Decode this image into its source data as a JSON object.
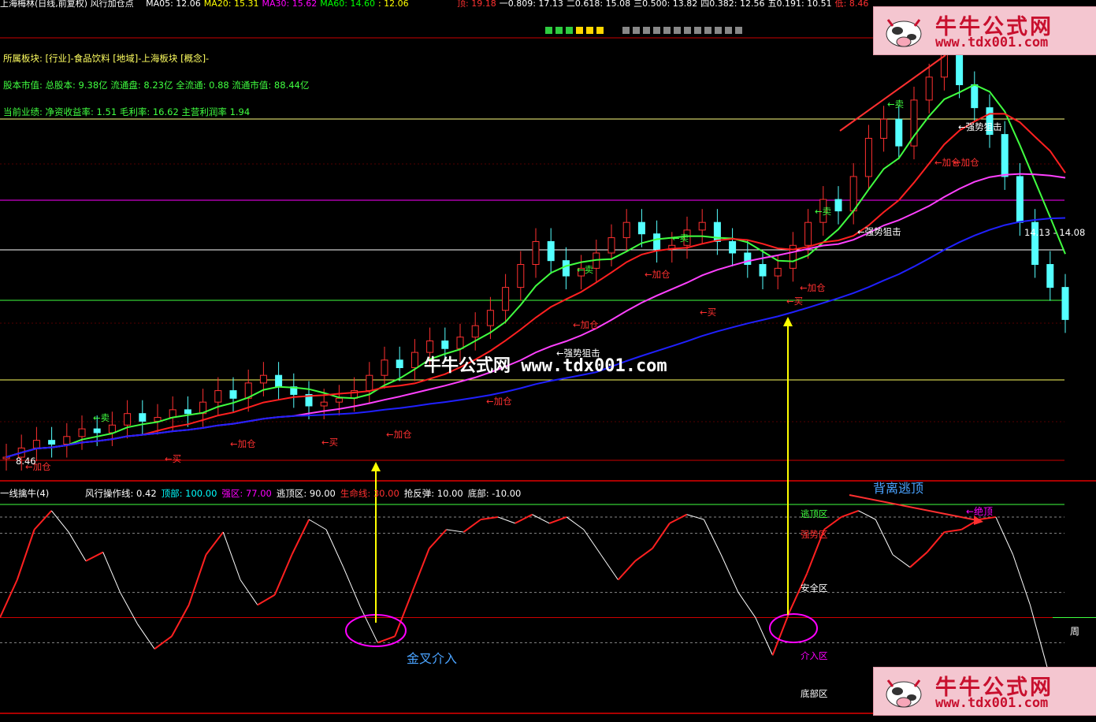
{
  "header": {
    "title": "上海梅林(日线,前复权) 风行加仓点",
    "ma": [
      {
        "label": "MA05: 12.06",
        "color": "#ffffff"
      },
      {
        "label": "MA20: 15.31",
        "color": "#ffff00"
      },
      {
        "label": "MA30: 15.62",
        "color": "#ff00ff"
      },
      {
        "label": "MA60: 14.60",
        "color": "#00ff00"
      },
      {
        "label": ": 12.06",
        "color": "#ffff00"
      }
    ],
    "levels": [
      {
        "label": "顶: 19.18",
        "color": "#ff3030"
      },
      {
        "label": "一0.809: 17.13",
        "color": "#ffffff"
      },
      {
        "label": "二0.618: 15.08",
        "color": "#ffffff"
      },
      {
        "label": "三0.500: 13.82",
        "color": "#ffffff"
      },
      {
        "label": "四0.382: 12.56",
        "color": "#ffffff"
      },
      {
        "label": "五0.191: 10.51",
        "color": "#ffffff"
      },
      {
        "label": "低: 8.46",
        "color": "#ff3030"
      }
    ]
  },
  "info_lines": [
    {
      "text": "所属板块: [行业]-食品饮料 [地域]-上海板块 [概念]-",
      "color": "#ffff60"
    },
    {
      "text": "股本市值: 总股本: 9.38亿 流通盘: 8.23亿 全流通: 0.88 流通市值: 88.44亿",
      "color": "#40ff40"
    },
    {
      "text": "当前业绩: 净资收益率: 1.51 毛利率: 16.62 主营利润率 1.94",
      "color": "#40ff40"
    }
  ],
  "watermark": {
    "site_name": "牛牛公式网",
    "site_url": "www.tdx001.com",
    "center_text": "牛牛公式网 www.tdx001.com"
  },
  "upper_annotations": [
    {
      "text": "←卖",
      "color": "#40ff40"
    },
    {
      "text": "←卖",
      "color": "#40ff40"
    },
    {
      "text": "←卖",
      "color": "#40ff40"
    },
    {
      "text": "←卖",
      "color": "#40ff40"
    },
    {
      "text": "←卖",
      "color": "#40ff40"
    },
    {
      "text": "←买",
      "color": "#ff3030"
    },
    {
      "text": "←买",
      "color": "#ff3030"
    },
    {
      "text": "←买",
      "color": "#ff3030"
    },
    {
      "text": "←买",
      "color": "#ff3030"
    },
    {
      "text": "←加仓",
      "color": "#ff3030"
    },
    {
      "text": "←加仓",
      "color": "#ff3030"
    },
    {
      "text": "←加仓",
      "color": "#ff3030"
    },
    {
      "text": "←加仓",
      "color": "#ff3030"
    },
    {
      "text": "←加仓",
      "color": "#ff3030"
    },
    {
      "text": "←加仓",
      "color": "#ff3030"
    },
    {
      "text": "←加仓",
      "color": "#ff3030"
    },
    {
      "text": "←加仓",
      "color": "#ff3030"
    },
    {
      "text": "←加仓",
      "color": "#ff3030"
    },
    {
      "text": "←强势狙击",
      "color": "#ffffff"
    },
    {
      "text": "←强势狙击",
      "color": "#ffffff"
    },
    {
      "text": "←强势狙击",
      "color": "#ffffff"
    },
    {
      "text": "8.46",
      "color": "#ffffff"
    },
    {
      "text": "14.13 - 14.08",
      "color": "#ffffff"
    }
  ],
  "indicator": {
    "title": "一线擒牛(4)",
    "params": [
      {
        "text": "风行操作线: 0.42",
        "color": "#ffffff"
      },
      {
        "text": "顶部: 100.00",
        "color": "#00ffff"
      },
      {
        "text": "强区: 77.00",
        "color": "#ff00ff"
      },
      {
        "text": "逃顶区: 90.00",
        "color": "#ffffff"
      },
      {
        "text": "生命线: 30.00",
        "color": "#ff3030"
      },
      {
        "text": "抢反弹: 10.00",
        "color": "#ffffff"
      },
      {
        "text": "底部: -10.00",
        "color": "#ffffff"
      }
    ],
    "zones": [
      {
        "text": "逃顶区",
        "color": "#40ff40"
      },
      {
        "text": "强势区",
        "color": "#ff3030"
      },
      {
        "text": "安全区",
        "color": "#ffffff"
      },
      {
        "text": "介入区",
        "color": "#ff00ff"
      },
      {
        "text": "底部区",
        "color": "#ffffff"
      }
    ],
    "annotations": [
      {
        "text": "金叉介入",
        "color": "#4aa3ff"
      },
      {
        "text": "背离逃顶",
        "color": "#4aa3ff"
      },
      {
        "text": "←绝顶",
        "color": "#ff00ff"
      },
      {
        "text": "周",
        "color": "#ffffff"
      }
    ]
  },
  "chart_data": {
    "type": "candlestick+line",
    "price_levels": [
      19.18,
      17.13,
      15.08,
      13.82,
      12.56,
      10.51,
      8.46
    ],
    "oscillator_levels": [
      100,
      90,
      77,
      30,
      10,
      -10
    ],
    "series": [
      {
        "name": "MA05",
        "color": "#ffffff"
      },
      {
        "name": "MA20",
        "color": "#ffff00"
      },
      {
        "name": "MA30",
        "color": "#ff00ff"
      },
      {
        "name": "MA60",
        "color": "#00ff00"
      }
    ],
    "closes_est": [
      8.46,
      8.7,
      8.9,
      8.8,
      9.0,
      9.2,
      9.1,
      9.3,
      9.6,
      9.4,
      9.5,
      9.7,
      9.6,
      9.9,
      10.2,
      10.0,
      10.4,
      10.6,
      10.3,
      10.1,
      9.8,
      9.9,
      10.0,
      10.2,
      10.6,
      11.0,
      10.8,
      11.2,
      11.5,
      11.3,
      11.6,
      11.9,
      12.3,
      12.9,
      13.5,
      14.1,
      13.6,
      13.2,
      13.4,
      13.8,
      14.2,
      14.6,
      14.3,
      13.9,
      14.0,
      14.4,
      14.6,
      14.1,
      13.8,
      13.5,
      13.2,
      13.4,
      14.0,
      14.6,
      15.2,
      14.9,
      15.8,
      16.8,
      17.3,
      16.6,
      17.8,
      18.4,
      19.0,
      18.2,
      17.6,
      16.9,
      15.8,
      14.6,
      13.5,
      12.9,
      12.06
    ],
    "oscillator_est": [
      10,
      40,
      80,
      95,
      78,
      55,
      62,
      30,
      5,
      -15,
      -5,
      20,
      60,
      78,
      40,
      20,
      28,
      60,
      88,
      80,
      50,
      18,
      -10,
      -5,
      30,
      65,
      80,
      78,
      88,
      90,
      85,
      92,
      85,
      90,
      80,
      60,
      40,
      55,
      65,
      85,
      92,
      88,
      60,
      30,
      10,
      -20,
      15,
      45,
      80,
      90,
      95,
      88,
      60,
      50,
      62,
      78,
      80,
      88,
      90,
      60,
      20,
      -30,
      -60
    ]
  }
}
